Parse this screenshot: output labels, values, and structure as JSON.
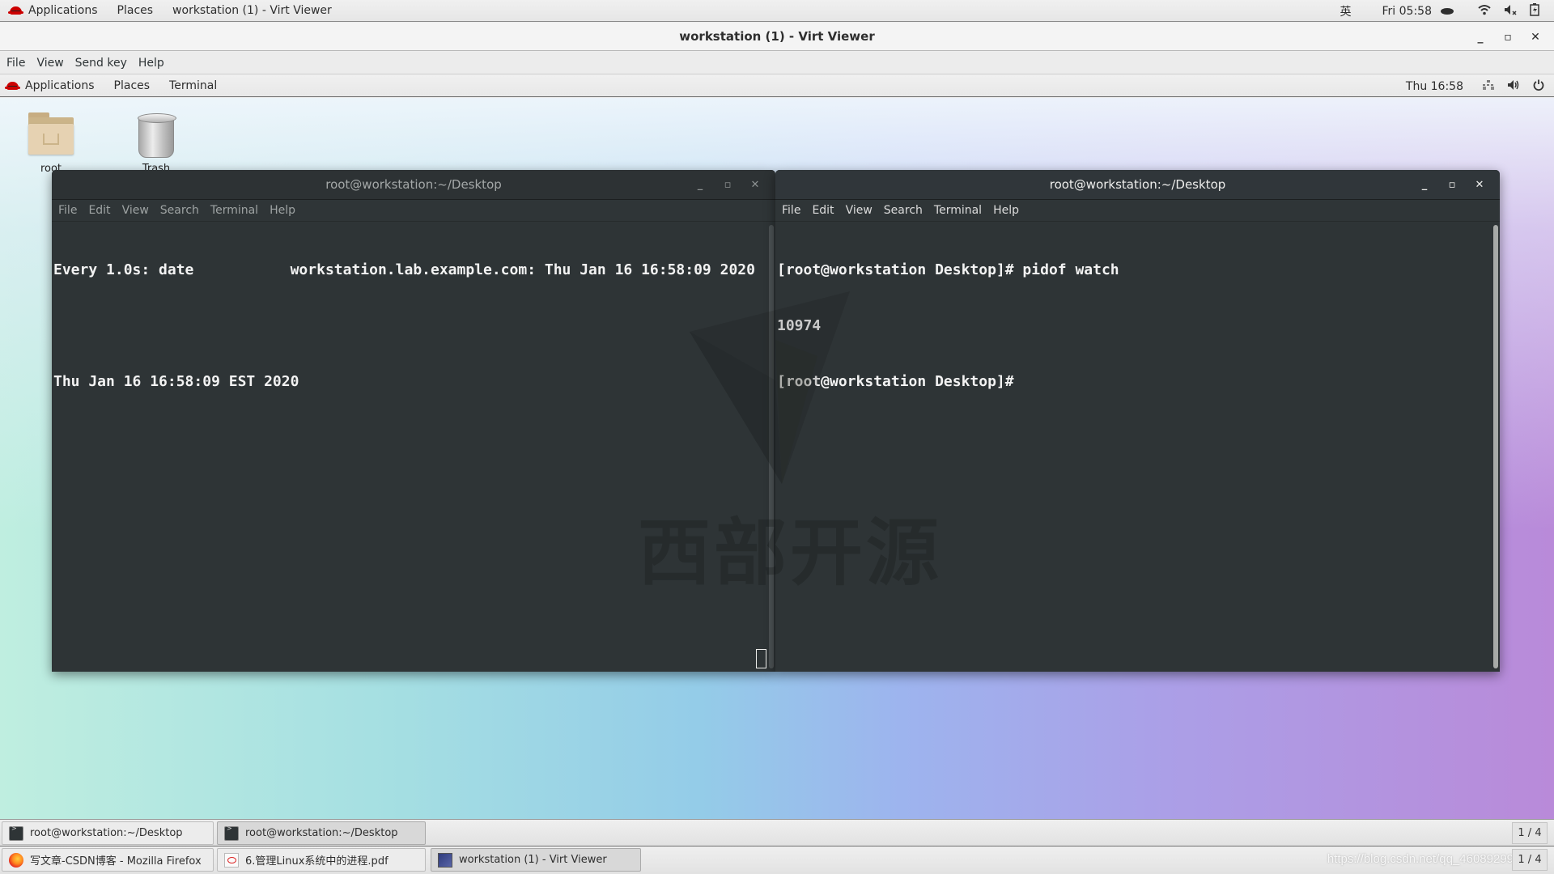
{
  "host_topbar": {
    "applications": "Applications",
    "places": "Places",
    "active_window": "workstation (1) - Virt Viewer",
    "input_method": "英",
    "clock": "Fri 05:58",
    "icons": [
      "wifi-icon",
      "volume-muted-icon",
      "battery-charging-icon"
    ]
  },
  "virt_viewer": {
    "title": "workstation (1) - Virt Viewer",
    "controls": {
      "minimize": "_",
      "maximize": "▫",
      "close": "✕"
    },
    "menu": [
      "File",
      "View",
      "Send key",
      "Help"
    ]
  },
  "guest_panel": {
    "applications": "Applications",
    "places": "Places",
    "terminal": "Terminal",
    "clock": "Thu 16:58",
    "icons": [
      "network-icon",
      "volume-icon",
      "power-icon"
    ]
  },
  "desktop_icons": [
    {
      "label": "root",
      "icon": "home-folder-icon"
    },
    {
      "label": "Trash",
      "icon": "trash-icon"
    }
  ],
  "terminals": [
    {
      "title": "root@workstation:~/Desktop",
      "menu": [
        "File",
        "Edit",
        "View",
        "Search",
        "Terminal",
        "Help"
      ],
      "lines": [
        "Every 1.0s: date           workstation.lab.example.com: Thu Jan 16 16:58:09 2020",
        "",
        "Thu Jan 16 16:58:09 EST 2020"
      ],
      "active": false
    },
    {
      "title": "root@workstation:~/Desktop",
      "menu": [
        "File",
        "Edit",
        "View",
        "Search",
        "Terminal",
        "Help"
      ],
      "lines": [
        "[root@workstation Desktop]# pidof watch",
        "10974",
        "[root@workstation Desktop]#"
      ],
      "active": true
    }
  ],
  "watermark": {
    "text": "西部开源"
  },
  "guest_taskbar": {
    "tasks": [
      "root@workstation:~/Desktop",
      "root@workstation:~/Desktop"
    ],
    "pager": "1 / 4"
  },
  "host_taskbar": {
    "tasks": [
      "写文章-CSDN博客 - Mozilla Firefox",
      "6.管理Linux系统中的进程.pdf",
      "workstation (1) - Virt Viewer"
    ],
    "pager": "1 / 4",
    "csdn_watermark": "https://blog.csdn.net/qq_46089299"
  }
}
